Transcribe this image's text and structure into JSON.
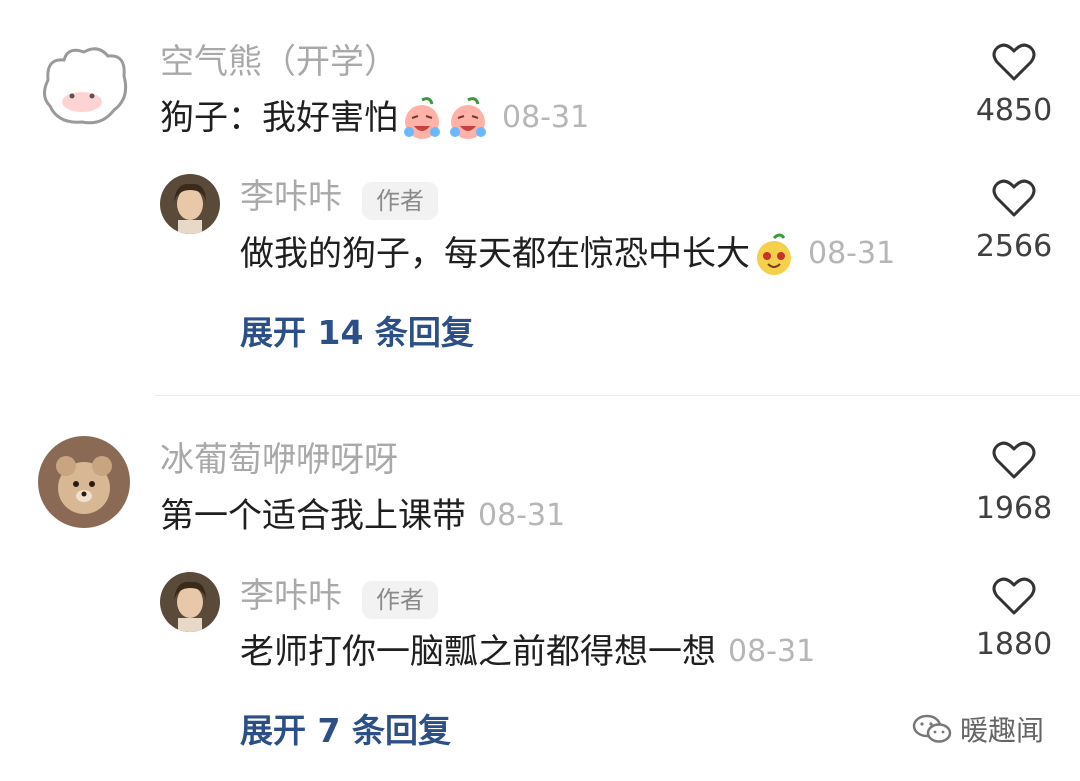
{
  "comments": [
    {
      "user": "空气熊（开学）",
      "text": "狗子：我好害怕",
      "date": "08-31",
      "likes": "4850",
      "reply": {
        "user": "李咔咔",
        "badge": "作者",
        "text": "做我的狗子，每天都在惊恐中长大",
        "date": "08-31",
        "likes": "2566"
      },
      "expand_label": "展开 14 条回复"
    },
    {
      "user": "冰葡萄咿咿呀呀",
      "text": "第一个适合我上课带",
      "date": "08-31",
      "likes": "1968",
      "reply": {
        "user": "李咔咔",
        "badge": "作者",
        "text": "老师打你一脑瓢之前都得想一想",
        "date": "08-31",
        "likes": "1880"
      },
      "expand_label": "展开 7 条回复"
    }
  ],
  "watermark": "暖趣闻",
  "colors": {
    "link": "#2b4f86",
    "name": "#a9a9a9",
    "text": "#1f1f1f",
    "date": "#b6b6b6"
  }
}
